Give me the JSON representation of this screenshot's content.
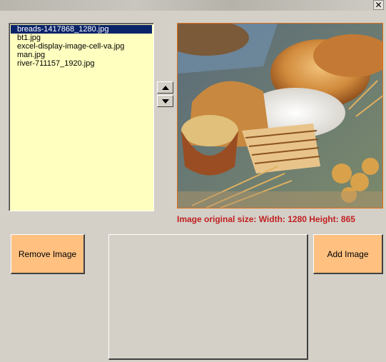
{
  "window": {
    "close_glyph": "✕"
  },
  "file_list": {
    "items": [
      "breads-1417868_1280.jpg",
      "bt1.jpg",
      "excel-display-image-cell-va.jpg",
      "man.jpg",
      "river-711157_1920.jpg"
    ],
    "selected_index": 0
  },
  "spin": {
    "up_icon": "triangle-up",
    "down_icon": "triangle-down"
  },
  "image_info": {
    "label": "Image original size: Width: 1280 Height: 865"
  },
  "buttons": {
    "remove_label": "Remove Image",
    "add_label": "Add Image"
  },
  "colors": {
    "list_background": "#ffffc0",
    "selection": "#0a246a",
    "button_fill": "#ffc080",
    "size_label": "#c02020",
    "image_border": "#e0701a"
  }
}
